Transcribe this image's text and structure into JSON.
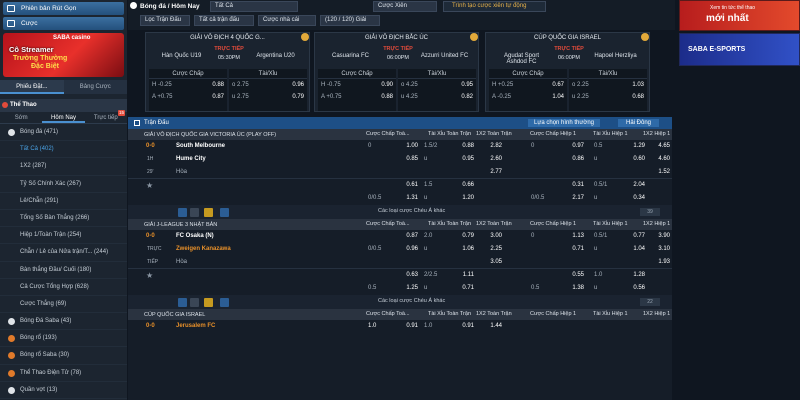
{
  "sidebar": {
    "btn1": "Phiên bản Rút Gọn",
    "btn2": "Cược",
    "banner": {
      "top": "SABA casino",
      "l1": "Cô Streamer",
      "l2": "Trường Thường",
      "l3": "Đặc Biệt"
    },
    "tabs": [
      "Phiếu Đặt...",
      "Bảng Cược"
    ],
    "section": "Thể Thao",
    "subtabs": [
      "Sớm",
      "Hôm Nay",
      "Trực tiếp"
    ],
    "badge": "15",
    "items": [
      {
        "label": "Bóng đá (471)",
        "type": "sport"
      },
      {
        "label": "Tất Cả (402)",
        "type": "act"
      },
      {
        "label": "1X2 (287)",
        "type": "sub"
      },
      {
        "label": "Tỷ Số Chính Xác (267)",
        "type": "sub"
      },
      {
        "label": "Lẻ/Chẵn (291)",
        "type": "sub"
      },
      {
        "label": "Tổng Số Bàn Thắng (266)",
        "type": "sub"
      },
      {
        "label": "Hiệp 1/Toàn Trận (254)",
        "type": "sub"
      },
      {
        "label": "Chẵn / Lẻ của Nửa trận/T... (244)",
        "type": "sub"
      },
      {
        "label": "Bàn thắng Đầu/ Cuối (180)",
        "type": "sub"
      },
      {
        "label": "Cả Cược Tổng Hợp (628)",
        "type": "sub"
      },
      {
        "label": "Cược Thắng (69)",
        "type": "sub"
      },
      {
        "label": "Bóng Đá Saba (43)",
        "type": "sport"
      },
      {
        "label": "Bóng rổ (193)",
        "type": "sport red"
      },
      {
        "label": "Bóng rổ Saba (30)",
        "type": "sport red"
      },
      {
        "label": "Thể Thao Điện Tử (78)",
        "type": "sport red"
      },
      {
        "label": "Quần vợt (13)",
        "type": "sport"
      }
    ]
  },
  "nav": {
    "title": "Bóng đá / Hôm Nay",
    "select1": "Tất Cả",
    "select2": "Cược Xiên",
    "link": "Trình tạo cược xiên tự động",
    "filter1": "Lọc Trận Đấu",
    "filter2": "Tất cả trận đấu",
    "filter3": "Cược nhà cái",
    "filter4": "(120 / 120) Giải"
  },
  "cards": [
    {
      "league": "GIẢI VÔ ĐỊCH 4 QUỐC G...",
      "home": "Hàn Quốc U19",
      "away": "Argentina U20",
      "live": "TRỰC TIẾP",
      "time": "05:30PM",
      "h1": "Cược Chấp",
      "h2": "Tài/Xỉu",
      "rows": [
        {
          "a": "H -0.25",
          "b": "0.88",
          "c": "o 2.75",
          "d": "0.96"
        },
        {
          "a": "A +0.75",
          "b": "0.87",
          "c": "u 2.75",
          "d": "0.79"
        }
      ]
    },
    {
      "league": "GIẢI VÔ ĐỊCH BẮC ÚC",
      "home": "Casuarina FC",
      "away": "Azzurri United FC",
      "live": "TRỰC TIẾP",
      "time": "06:00PM",
      "h1": "Cược Chấp",
      "h2": "Tài/Xỉu",
      "rows": [
        {
          "a": "H -0.75",
          "b": "0.90",
          "c": "o 4.25",
          "d": "0.95"
        },
        {
          "a": "A +0.75",
          "b": "0.88",
          "c": "u 4.25",
          "d": "0.82"
        }
      ]
    },
    {
      "league": "CÚP QUỐC GIA ISRAEL",
      "home": "Agudat Sport Ashdod FC",
      "away": "Hapoel Herzliya",
      "live": "TRỰC TIẾP",
      "time": "06:00PM",
      "h1": "Cược Chấp",
      "h2": "Tài/Xỉu",
      "rows": [
        {
          "a": "H +0.25",
          "b": "0.67",
          "c": "o 2.25",
          "d": "1.03"
        },
        {
          "a": "A -0.25",
          "b": "1.04",
          "c": "u 2.25",
          "d": "0.68"
        }
      ]
    }
  ],
  "ads": {
    "ad1_top": "Xem tin tức thể thao",
    "ad1_main": "mới nhất",
    "ad2": "SABA E-SPORTS"
  },
  "main": {
    "bar_label": "Trận Đấu",
    "bar_select": "Lựa chọn hình thường",
    "bar_sort": "Hải Đông",
    "cols": [
      "Cược Chấp Toà...",
      "Tài Xỉu Toàn Trận",
      "1X2 Toàn Trận",
      "Cược Chấp Hiệp 1",
      "Tài Xỉu Hiệp 1",
      "1X2 Hiệp 1"
    ],
    "more": "Các loại cược Chéu Á khác",
    "leagues": [
      {
        "name": "GIẢI VÔ ĐỊCH QUỐC GIA VICTORIA ÚC (PLAY OFF)",
        "score": "0-0",
        "half": "1H",
        "minute": "29'",
        "home": "South Melbourne",
        "away": "Hume City",
        "draw": "Hòa",
        "pg": "39",
        "rows": [
          [
            "0",
            "",
            "1.00",
            "1.5/2",
            "0.88",
            "2.82",
            "0",
            "",
            "0.97",
            "0.5",
            "1.29",
            "4.65"
          ],
          [
            "",
            "",
            "0.85",
            "u",
            "0.95",
            "2.60",
            "",
            "",
            "0.86",
            "u",
            "0.60",
            "4.60"
          ],
          [
            "",
            "",
            "",
            "",
            "",
            "2.77",
            "",
            "",
            "",
            "",
            "",
            "1.52"
          ],
          [
            "",
            "",
            "0.61",
            "1.5",
            "0.66",
            "",
            "",
            "",
            "0.31",
            "0.5/1",
            "2.04",
            ""
          ],
          [
            "0/0.5",
            "",
            "1.31",
            "u",
            "1.20",
            "",
            "0/0.5",
            "",
            "2.17",
            "u",
            "0.34",
            ""
          ]
        ]
      },
      {
        "name": "GIẢI J-LEAGUE 3 NHẬT BẢN",
        "score": "0-0",
        "half": "TRỰC",
        "minute": "TIẾP",
        "home": "FC Osaka (N)",
        "away": "Zweigen Kanazawa",
        "draw": "Hòa",
        "pg": "22",
        "rows": [
          [
            "",
            "",
            "0.87",
            "2.0",
            "0.79",
            "3.00",
            "0",
            "",
            "1.13",
            "0.5/1",
            "0.77",
            "3.90"
          ],
          [
            "0/0.5",
            "",
            "0.96",
            "u",
            "1.06",
            "2.25",
            "",
            "",
            "0.71",
            "u",
            "1.04",
            "3.10"
          ],
          [
            "",
            "",
            "",
            "",
            "",
            "3.05",
            "",
            "",
            "",
            "",
            "",
            "1.93"
          ],
          [
            "",
            "",
            "0.63",
            "2/2.5",
            "1.11",
            "",
            "",
            "",
            "0.55",
            "1.0",
            "1.28",
            ""
          ],
          [
            "0.5",
            "",
            "1.25",
            "u",
            "0.71",
            "",
            "0.5",
            "",
            "1.38",
            "u",
            "0.56",
            ""
          ]
        ]
      },
      {
        "name": "CÚP QUỐC GIA ISRAEL",
        "score": "0-0",
        "home": "Jerusalem FC",
        "row": [
          "",
          "",
          "1.0",
          "0.91",
          "1.0",
          "0.91",
          "1.44"
        ]
      }
    ]
  }
}
